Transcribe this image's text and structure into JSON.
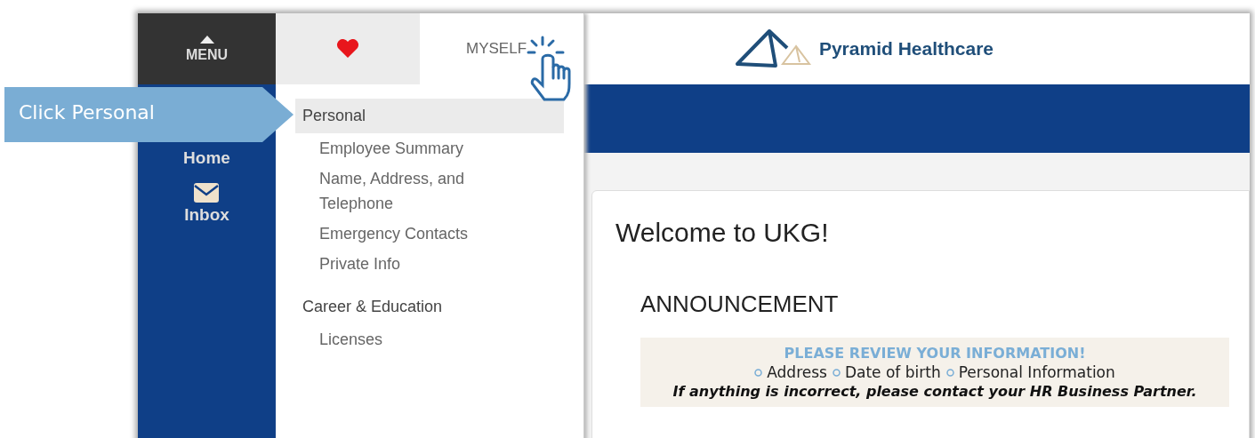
{
  "callout": {
    "text": "Click Personal"
  },
  "nav": {
    "menu_label": "MENU",
    "items": [
      {
        "label": "Home",
        "kind": "home"
      },
      {
        "label": "Inbox",
        "kind": "inbox"
      }
    ]
  },
  "menu_panel": {
    "tabs": [
      {
        "kind": "favorites",
        "selected": false
      },
      {
        "kind": "text",
        "label": "MYSELF",
        "selected": true
      }
    ],
    "groups": [
      {
        "title": "Personal",
        "selected": true,
        "items": [
          "Employee Summary",
          "Name, Address, and Telephone",
          "Emergency Contacts",
          "Private Info"
        ]
      },
      {
        "title": "Career & Education",
        "selected": false,
        "items": [
          "Licenses"
        ]
      }
    ]
  },
  "header": {
    "brand": "Pyramid Healthcare"
  },
  "content": {
    "title": "Welcome to UKG!",
    "section": "ANNOUNCEMENT",
    "notice": {
      "heading": "PLEASE REVIEW YOUR INFORMATION!",
      "items": [
        "Address",
        "Date of birth",
        "Personal Information"
      ],
      "footer": "If anything is incorrect, please contact your HR Business Partner."
    }
  }
}
